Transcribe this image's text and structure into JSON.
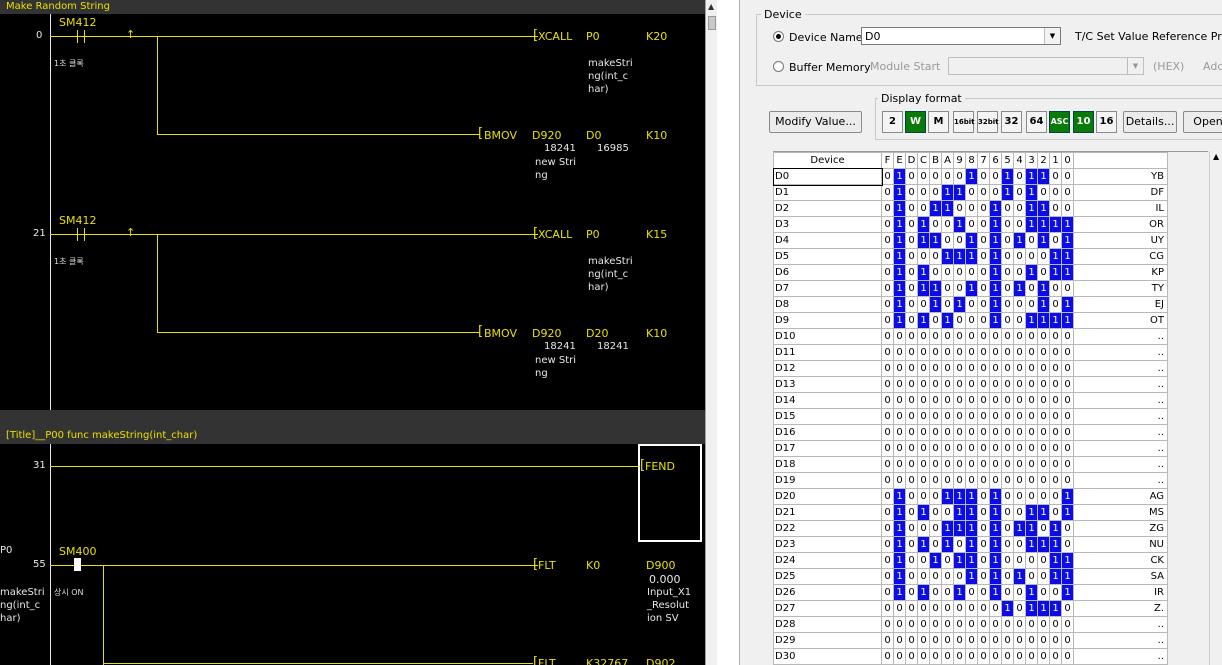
{
  "ladder": {
    "header_title": "Make Random String",
    "section_title": "[Title]__P00 func makeString(int_char)",
    "steps": {
      "s0": "0",
      "s21": "21",
      "s31": "31",
      "s55": "55"
    },
    "contacts": {
      "c1": "SM412",
      "c1_comment": "1초 클록",
      "c2": "SM412",
      "c2_comment": "1초 클록",
      "c3": "SM400",
      "c3_comment": "상시 ON"
    },
    "row0": {
      "instr": "XCALL",
      "op1": "P0",
      "op2": "K20",
      "op1_comment": [
        "makeStri",
        "ng(int_c",
        "har)"
      ],
      "instr2": "BMOV",
      "op3": "D920",
      "op4": "D0",
      "op5": "K10",
      "op3_val": "18241",
      "op4_val": "16985",
      "op3_comment": [
        "new Stri",
        "ng"
      ]
    },
    "row21": {
      "instr": "XCALL",
      "op1": "P0",
      "op2": "K15",
      "op1_comment": [
        "makeStri",
        "ng(int_c",
        "har)"
      ],
      "instr2": "BMOV",
      "op3": "D920",
      "op4": "D20",
      "op5": "K10",
      "op3_val": "18241",
      "op4_val": "18241",
      "op3_comment": [
        "new Stri",
        "ng"
      ]
    },
    "row31": {
      "instr": "FEND"
    },
    "row55": {
      "label": "P0",
      "label_comment": [
        "makeStri",
        "ng(int_c",
        "har)"
      ],
      "instr": "FLT",
      "op1": "K0",
      "op2": "D900",
      "op2_val": "0.000",
      "op2_comment": [
        "Input_X1",
        "_Resolut",
        "ion SV"
      ],
      "instr2": "FLT",
      "op3": "K32767",
      "op4": "D902"
    }
  },
  "panel": {
    "device_group": "Device",
    "device_name_label": "Device Name",
    "device_name_value": "D0",
    "tc_label": "T/C Set Value Reference Progr",
    "buffer_memory_label": "Buffer Memory",
    "module_start_label": "Module Start",
    "hex_label": "(HEX)",
    "addr_label": "Addr",
    "display_format_label": "Display format",
    "modify_button": "Modify Value...",
    "details_button": "Details...",
    "open_button": "Open",
    "format_buttons": [
      "2",
      "W",
      "M",
      "16bit",
      "32bit",
      "32",
      "64",
      "ASC",
      "10",
      "16"
    ],
    "device_col_header": "Device",
    "bit_headers": [
      "F",
      "E",
      "D",
      "C",
      "B",
      "A",
      "9",
      "8",
      "7",
      "6",
      "5",
      "4",
      "3",
      "2",
      "1",
      "0"
    ],
    "rows": [
      {
        "device": "D0",
        "bits": "0100000100101100",
        "ascii": "YB"
      },
      {
        "device": "D1",
        "bits": "0100011000101000",
        "ascii": "DF"
      },
      {
        "device": "D2",
        "bits": "0100110001001100",
        "ascii": "IL"
      },
      {
        "device": "D3",
        "bits": "0101001001001111",
        "ascii": "OR"
      },
      {
        "device": "D4",
        "bits": "0101100101010101",
        "ascii": "UY"
      },
      {
        "device": "D5",
        "bits": "0100011101000011",
        "ascii": "CG"
      },
      {
        "device": "D6",
        "bits": "0101000001001011",
        "ascii": "KP"
      },
      {
        "device": "D7",
        "bits": "0101100101010100",
        "ascii": "TY"
      },
      {
        "device": "D8",
        "bits": "0100101001000101",
        "ascii": "EJ"
      },
      {
        "device": "D9",
        "bits": "0101010001001111",
        "ascii": "OT"
      },
      {
        "device": "D10",
        "bits": "0000000000000000",
        "ascii": ".."
      },
      {
        "device": "D11",
        "bits": "0000000000000000",
        "ascii": ".."
      },
      {
        "device": "D12",
        "bits": "0000000000000000",
        "ascii": ".."
      },
      {
        "device": "D13",
        "bits": "0000000000000000",
        "ascii": ".."
      },
      {
        "device": "D14",
        "bits": "0000000000000000",
        "ascii": ".."
      },
      {
        "device": "D15",
        "bits": "0000000000000000",
        "ascii": ".."
      },
      {
        "device": "D16",
        "bits": "0000000000000000",
        "ascii": ".."
      },
      {
        "device": "D17",
        "bits": "0000000000000000",
        "ascii": ".."
      },
      {
        "device": "D18",
        "bits": "0000000000000000",
        "ascii": ".."
      },
      {
        "device": "D19",
        "bits": "0000000000000000",
        "ascii": ".."
      },
      {
        "device": "D20",
        "bits": "0100011101000001",
        "ascii": "AG"
      },
      {
        "device": "D21",
        "bits": "0101001101001101",
        "ascii": "MS"
      },
      {
        "device": "D22",
        "bits": "0100011101011010",
        "ascii": "ZG"
      },
      {
        "device": "D23",
        "bits": "0101010101001110",
        "ascii": "NU"
      },
      {
        "device": "D24",
        "bits": "0100101101000011",
        "ascii": "CK"
      },
      {
        "device": "D25",
        "bits": "0100000101010011",
        "ascii": "SA"
      },
      {
        "device": "D26",
        "bits": "0101001001001001",
        "ascii": "IR"
      },
      {
        "device": "D27",
        "bits": "0000000000101110",
        "ascii": "Z."
      },
      {
        "device": "D28",
        "bits": "0000000000000000",
        "ascii": ".."
      },
      {
        "device": "D29",
        "bits": "0000000000000000",
        "ascii": ".."
      },
      {
        "device": "D30",
        "bits": "0000000000000000",
        "ascii": ".."
      }
    ]
  }
}
